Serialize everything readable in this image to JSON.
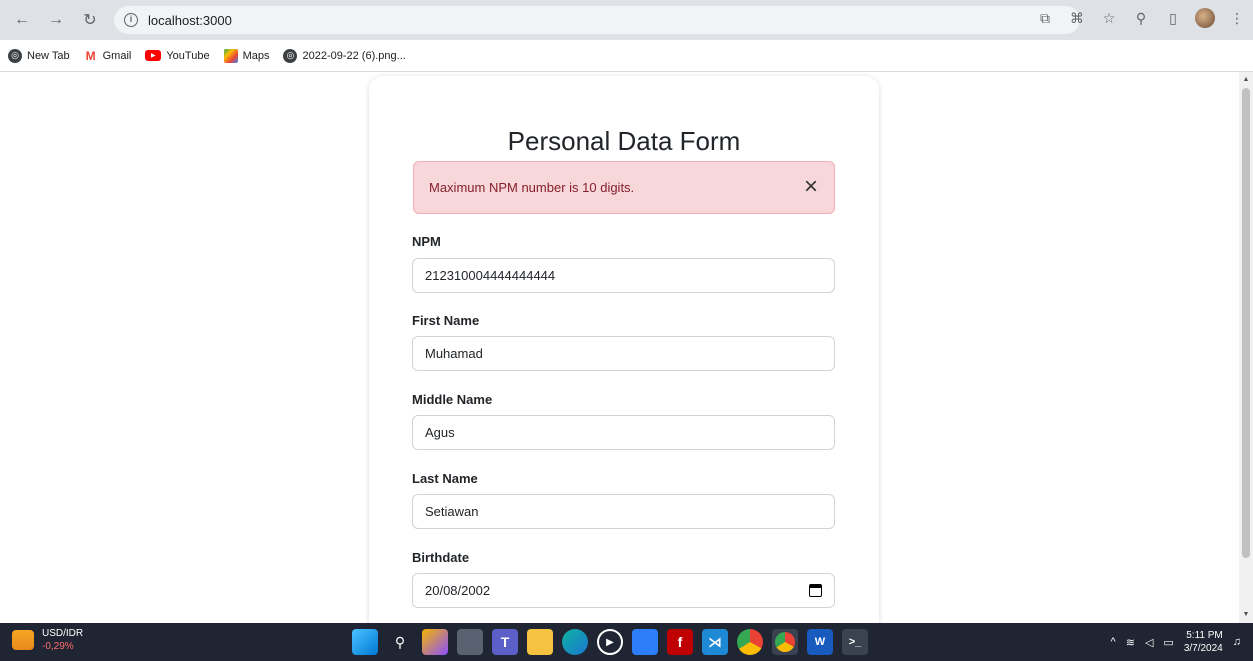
{
  "browser": {
    "url": "localhost:3000",
    "bookmarks": [
      {
        "label": "New Tab",
        "icon": "globe-icon"
      },
      {
        "label": "Gmail",
        "icon": "gmail-icon"
      },
      {
        "label": "YouTube",
        "icon": "youtube-icon"
      },
      {
        "label": "Maps",
        "icon": "maps-icon"
      },
      {
        "label": "2022-09-22 (6).png...",
        "icon": "globe-icon"
      }
    ]
  },
  "form": {
    "title": "Personal Data Form",
    "alert": {
      "message": "Maximum NPM number is 10 digits.",
      "close_symbol": "×"
    },
    "fields": [
      {
        "label": "NPM",
        "value": "212310004444444444"
      },
      {
        "label": "First Name",
        "value": "Muhamad"
      },
      {
        "label": "Middle Name",
        "value": "Agus"
      },
      {
        "label": "Last Name",
        "value": "Setiawan"
      },
      {
        "label": "Birthdate",
        "value": "20/08/2002"
      }
    ]
  },
  "taskbar": {
    "widget_title": "USD/IDR",
    "widget_value": "-0,29%",
    "time": "5:11 PM",
    "date": "3/7/2024"
  },
  "colors": {
    "alert_bg": "#f8d7da",
    "alert_text": "#842029",
    "taskbar_bg": "#1f2533"
  }
}
